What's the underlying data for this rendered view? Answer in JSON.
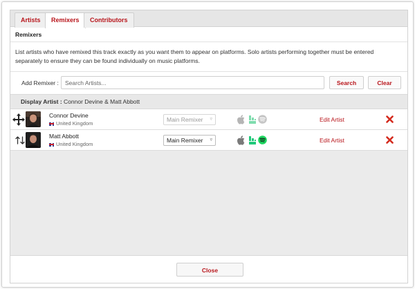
{
  "tabs": [
    {
      "label": "Artists",
      "active": false
    },
    {
      "label": "Remixers",
      "active": true
    },
    {
      "label": "Contributors",
      "active": false
    }
  ],
  "section": {
    "title": "Remixers"
  },
  "description": "List artists who have remixed this track exactly as you want them to appear on platforms. Solo artists performing together must be entered separately to ensure they can be found individually on music platforms.",
  "add_remixer": {
    "label": "Add Remixer :",
    "placeholder": "Search Artists...",
    "value": "",
    "search_label": "Search",
    "clear_label": "Clear"
  },
  "display_artist": {
    "label": "Display Artist :",
    "value": "Connor Devine & Matt Abbott"
  },
  "remixers": [
    {
      "name": "Connor Devine",
      "country": "United Kingdom",
      "role": "Main Remixer",
      "role_disabled": true,
      "handle_icon": "move-icon",
      "platforms": [
        "apple-music-icon",
        "bandsintown-icon",
        "spotify-icon"
      ],
      "platforms_active": false,
      "edit_label": "Edit Artist",
      "remove_icon": "close-x-icon"
    },
    {
      "name": "Matt Abbott",
      "country": "United Kingdom",
      "role": "Main Remixer",
      "role_disabled": false,
      "handle_icon": "sort-arrows-icon",
      "platforms": [
        "apple-music-icon",
        "bandsintown-icon",
        "spotify-icon"
      ],
      "platforms_active": true,
      "edit_label": "Edit Artist",
      "remove_icon": "close-x-icon"
    }
  ],
  "footer": {
    "close_label": "Close"
  },
  "colors": {
    "accent": "#b8151b",
    "remove": "#d42b1e",
    "spotify": "#1ed760",
    "bandsintown": "#20c97a"
  }
}
